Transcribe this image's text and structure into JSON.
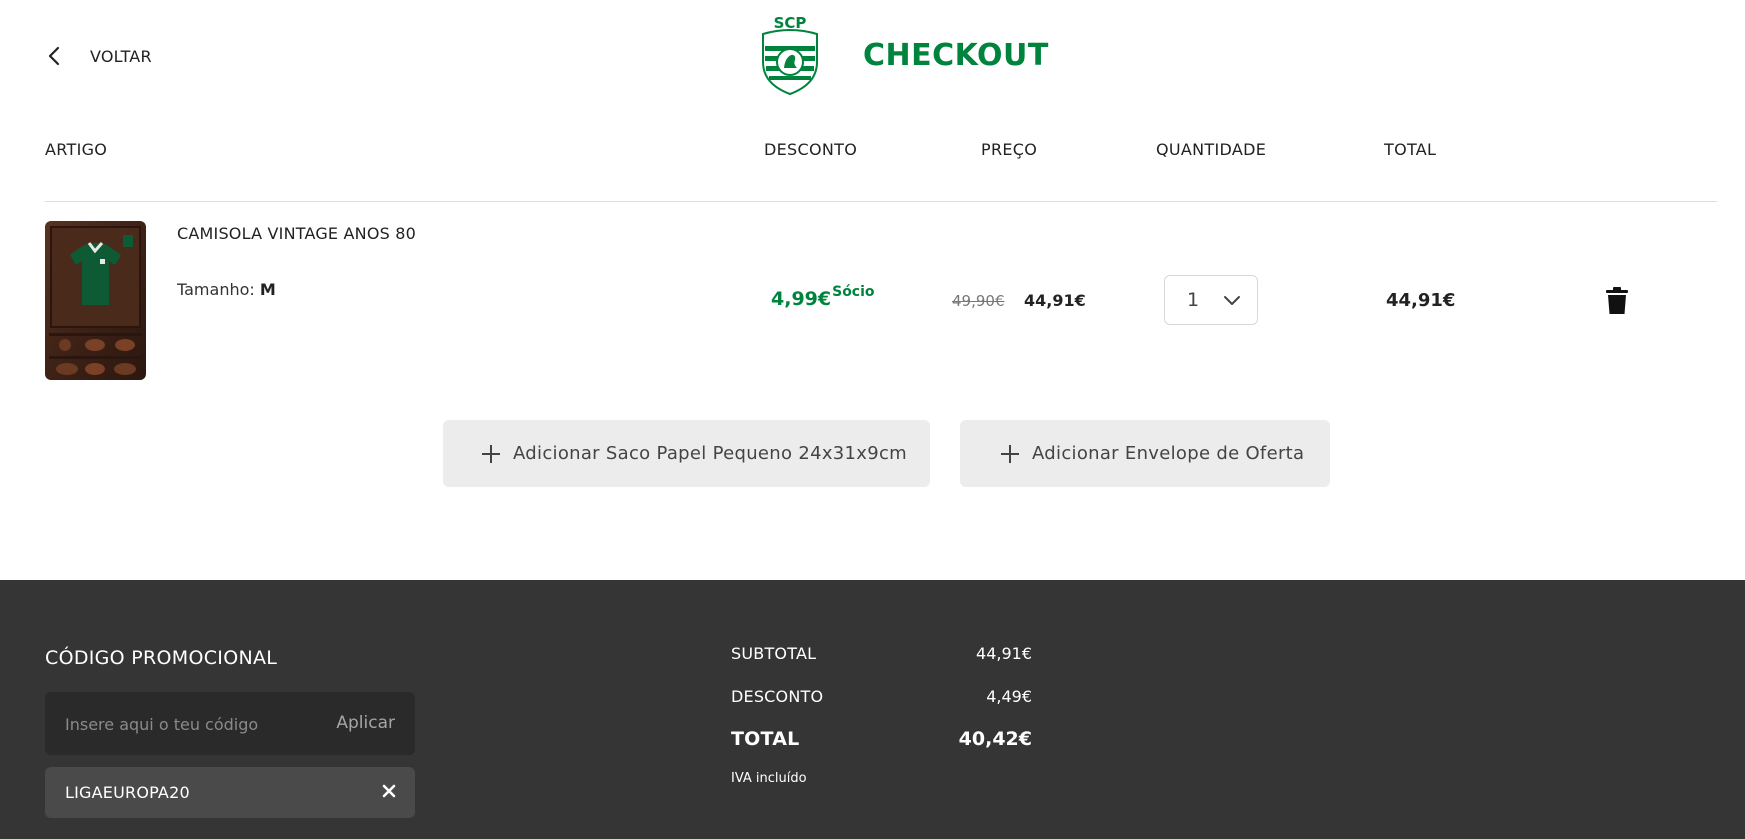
{
  "header": {
    "back_label": "VOLTAR",
    "logo_text": "SCP SPORTING PORTUGAL",
    "title": "CHECKOUT"
  },
  "columns": {
    "artigo": "ARTIGO",
    "desconto": "DESCONTO",
    "preco": "PREÇO",
    "quantidade": "QUANTIDADE",
    "total": "TOTAL"
  },
  "item": {
    "name": "CAMISOLA VINTAGE ANOS 80",
    "size_label": "Tamanho:",
    "size_value": "M",
    "discount": "4,99€",
    "discount_tag": "Sócio",
    "old_price": "49,90€",
    "price": "44,91€",
    "quantity": "1",
    "total": "44,91€"
  },
  "addons": [
    {
      "label": "Adicionar Saco Papel Pequeno 24x31x9cm"
    },
    {
      "label": "Adicionar Envelope de Oferta"
    }
  ],
  "promo": {
    "title": "CÓDIGO PROMOCIONAL",
    "placeholder": "Insere aqui o teu código",
    "apply_label": "Aplicar",
    "applied_code": "LIGAEUROPA20"
  },
  "summary": {
    "subtotal_label": "SUBTOTAL",
    "subtotal_value": "44,91€",
    "discount_label": "DESCONTO",
    "discount_value": "4,49€",
    "total_label": "TOTAL",
    "total_value": "40,42€",
    "tax_note": "IVA incluído"
  },
  "colors": {
    "brand_green": "#00843d",
    "footer_bg": "#353535",
    "addon_bg": "#ececec"
  }
}
